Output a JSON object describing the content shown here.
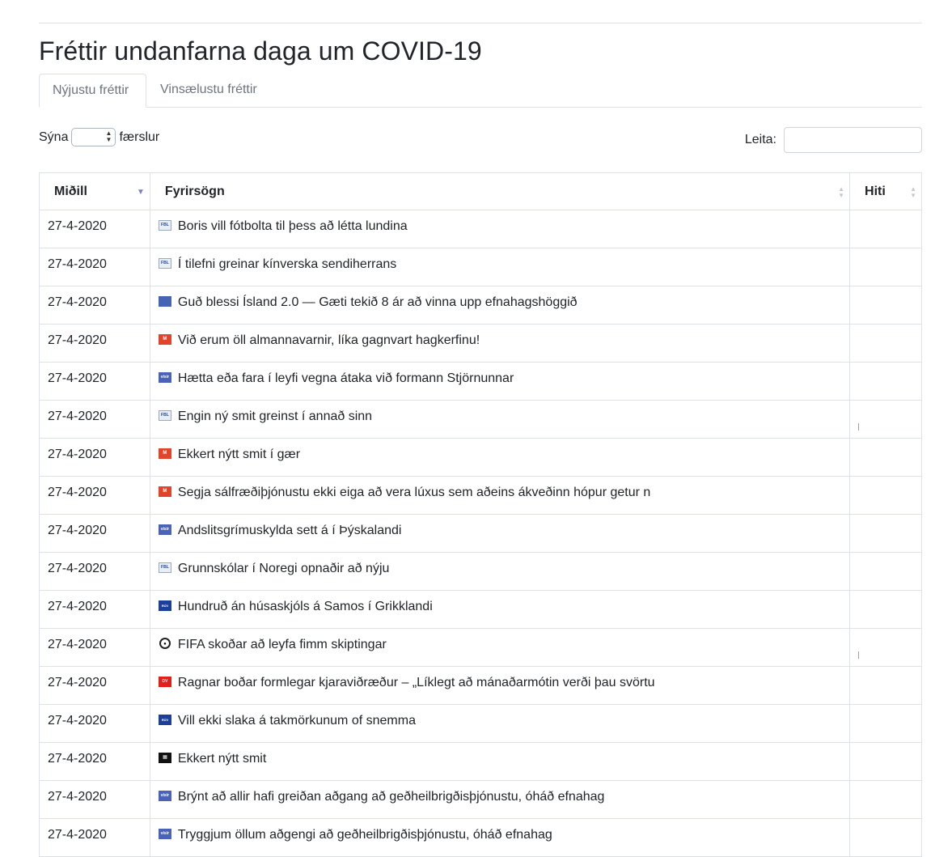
{
  "page": {
    "title": "Fréttir undanfarna daga um COVID-19"
  },
  "tabs": [
    {
      "label": "Nýjustu fréttir",
      "active": true
    },
    {
      "label": "Vinsælustu fréttir",
      "active": false
    }
  ],
  "length_control": {
    "prefix": "Sýna",
    "suffix": "færslur",
    "selected": ""
  },
  "search": {
    "label": "Leita:",
    "value": ""
  },
  "table": {
    "columns": [
      "Miðill",
      "Fyrirsögn",
      "Hiti"
    ],
    "sort": {
      "column": "Miðill",
      "direction": "desc"
    },
    "rows": [
      {
        "date": "27-4-2020",
        "source_icon": "fbl-icon",
        "headline": "Boris vill fótbolta til þess að létta lundina",
        "heat": null
      },
      {
        "date": "27-4-2020",
        "source_icon": "fbl-icon",
        "headline": "Í tilefni greinar kínverska sendiherrans",
        "heat": null
      },
      {
        "date": "27-4-2020",
        "source_icon": "kjarninn-icon",
        "headline": "Guð blessi Ísland 2.0 — Gæti tekið 8 ár að vinna upp efnahagshöggið",
        "heat": null
      },
      {
        "date": "27-4-2020",
        "source_icon": "mbl-icon",
        "headline": "Við erum öll almannavarnir, líka gagnvart hagkerfinu!",
        "heat": null
      },
      {
        "date": "27-4-2020",
        "source_icon": "visir-icon",
        "headline": "Hætta eða fara í leyfi vegna átaka við formann Stjörnunnar",
        "heat": null
      },
      {
        "date": "27-4-2020",
        "source_icon": "fbl-icon",
        "headline": "Engin ný smit greinst í annað sinn",
        "heat": 0.02
      },
      {
        "date": "27-4-2020",
        "source_icon": "mbl-icon",
        "headline": "Ekkert nýtt smit í gær",
        "heat": null
      },
      {
        "date": "27-4-2020",
        "source_icon": "mbl-icon",
        "headline": "Segja sálfræðiþjónustu ekki eiga að vera lúxus sem aðeins ákveðinn hópur getur n",
        "heat": null
      },
      {
        "date": "27-4-2020",
        "source_icon": "visir-icon",
        "headline": "Andslitsgrímuskylda sett á í Þýskalandi",
        "heat": null
      },
      {
        "date": "27-4-2020",
        "source_icon": "fbl-icon",
        "headline": "Grunnskólar í Noregi opnaðir að nýju",
        "heat": null
      },
      {
        "date": "27-4-2020",
        "source_icon": "ruv-icon",
        "headline": "Hundruð án húsaskjóls á Samos í Grikklandi",
        "heat": null
      },
      {
        "date": "27-4-2020",
        "source_icon": "fotbolti-icon",
        "headline": "FIFA skoðar að leyfa fimm skiptingar",
        "heat": 0.01
      },
      {
        "date": "27-4-2020",
        "source_icon": "dv-icon",
        "headline": "Ragnar boðar formlegar kjaraviðræður – „Líklegt að mánaðarmótin verði þau svörtu",
        "heat": null
      },
      {
        "date": "27-4-2020",
        "source_icon": "ruv-icon",
        "headline": "Vill ekki slaka á takmörkunum of snemma",
        "heat": null
      },
      {
        "date": "27-4-2020",
        "source_icon": "black-icon",
        "headline": "Ekkert nýtt smit",
        "heat": null
      },
      {
        "date": "27-4-2020",
        "source_icon": "visir-icon",
        "headline": "Brýnt að allir hafi greiðan aðgang að geðheilbrigðisþjónustu, óháð efnahag",
        "heat": null
      },
      {
        "date": "27-4-2020",
        "source_icon": "visir-icon",
        "headline": "Tryggjum öllum aðgengi að geðheilbrigðisþjónustu, óháð efnahag",
        "heat": null
      }
    ]
  },
  "colors": {
    "border": "#dee2e6",
    "sort_active": "#7b7fc4",
    "heat_bar": "#6fa8dc"
  }
}
